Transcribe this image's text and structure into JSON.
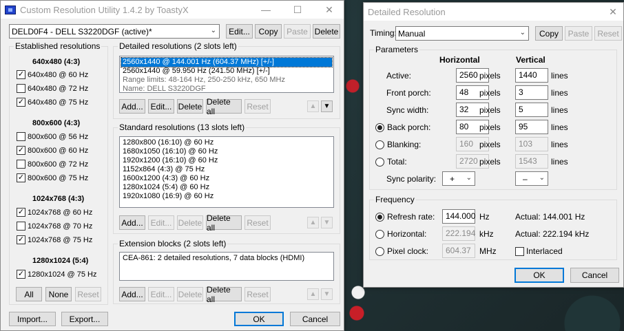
{
  "main": {
    "title": "Custom Resolution Utility 1.4.2 by ToastyX",
    "monitor_select": "DELD0F4 - DELL S3220DGF (active)*",
    "buttons": {
      "edit": "Edit...",
      "copy": "Copy",
      "paste": "Paste",
      "delete": "Delete"
    },
    "established": {
      "label": "Established resolutions",
      "groups": [
        {
          "header": "640x480 (4:3)",
          "items": [
            {
              "label": "640x480 @ 60 Hz",
              "checked": true
            },
            {
              "label": "640x480 @ 72 Hz",
              "checked": false
            },
            {
              "label": "640x480 @ 75 Hz",
              "checked": true
            }
          ]
        },
        {
          "header": "800x600 (4:3)",
          "items": [
            {
              "label": "800x600 @ 56 Hz",
              "checked": false
            },
            {
              "label": "800x600 @ 60 Hz",
              "checked": true
            },
            {
              "label": "800x600 @ 72 Hz",
              "checked": false
            },
            {
              "label": "800x600 @ 75 Hz",
              "checked": true
            }
          ]
        },
        {
          "header": "1024x768 (4:3)",
          "items": [
            {
              "label": "1024x768 @ 60 Hz",
              "checked": true
            },
            {
              "label": "1024x768 @ 70 Hz",
              "checked": false
            },
            {
              "label": "1024x768 @ 75 Hz",
              "checked": true
            }
          ]
        },
        {
          "header": "1280x1024 (5:4)",
          "items": [
            {
              "label": "1280x1024 @ 75 Hz",
              "checked": true
            }
          ]
        }
      ],
      "all": "All",
      "none": "None",
      "reset": "Reset"
    },
    "detailed": {
      "label": "Detailed resolutions (2 slots left)",
      "rows": [
        "2560x1440 @ 144.001 Hz (604.37 MHz) [+/-]",
        "2560x1440 @ 59.950 Hz (241.50 MHz) [+/-]",
        "Range limits: 48-164 Hz, 250-250 kHz, 650 MHz",
        "Name: DELL S3220DGF"
      ],
      "add": "Add...",
      "edit": "Edit...",
      "delete": "Delete",
      "delete_all": "Delete all",
      "reset": "Reset"
    },
    "standard": {
      "label": "Standard resolutions (13 slots left)",
      "rows": [
        "1280x800 (16:10) @ 60 Hz",
        "1680x1050 (16:10) @ 60 Hz",
        "1920x1200 (16:10) @ 60 Hz",
        "1152x864 (4:3) @ 75 Hz",
        "1600x1200 (4:3) @ 60 Hz",
        "1280x1024 (5:4) @ 60 Hz",
        "1920x1080 (16:9) @ 60 Hz"
      ],
      "add": "Add...",
      "edit": "Edit...",
      "delete": "Delete",
      "delete_all": "Delete all",
      "reset": "Reset"
    },
    "extension": {
      "label": "Extension blocks (2 slots left)",
      "rows": [
        "CEA-861: 2 detailed resolutions, 7 data blocks (HDMI)"
      ],
      "add": "Add...",
      "edit": "Edit...",
      "delete": "Delete",
      "delete_all": "Delete all",
      "reset": "Reset"
    },
    "footer": {
      "import": "Import...",
      "export": "Export...",
      "ok": "OK",
      "cancel": "Cancel"
    }
  },
  "detail": {
    "title": "Detailed Resolution",
    "timing_label": "Timing:",
    "timing_value": "Manual",
    "copy": "Copy",
    "paste": "Paste",
    "reset": "Reset",
    "parameters": {
      "label": "Parameters",
      "col_h": "Horizontal",
      "col_v": "Vertical",
      "rows": [
        {
          "label": "Active:",
          "h": "2560",
          "h_unit": "pixels",
          "v": "1440",
          "v_unit": "lines",
          "radio": false
        },
        {
          "label": "Front porch:",
          "h": "48",
          "h_unit": "pixels",
          "v": "3",
          "v_unit": "lines",
          "radio": false
        },
        {
          "label": "Sync width:",
          "h": "32",
          "h_unit": "pixels",
          "v": "5",
          "v_unit": "lines",
          "radio": false
        },
        {
          "label": "Back porch:",
          "h": "80",
          "h_unit": "pixels",
          "v": "95",
          "v_unit": "lines",
          "radio": true,
          "selected": true
        },
        {
          "label": "Blanking:",
          "h": "160",
          "h_unit": "pixels",
          "v": "103",
          "v_unit": "lines",
          "radio": true,
          "selected": false
        },
        {
          "label": "Total:",
          "h": "2720",
          "h_unit": "pixels",
          "v": "1543",
          "v_unit": "lines",
          "radio": true,
          "selected": false
        }
      ],
      "sync_polarity_label": "Sync polarity:",
      "h_polarity": "+",
      "v_polarity": "–"
    },
    "frequency": {
      "label": "Frequency",
      "refresh_label": "Refresh rate:",
      "refresh_value": "144.000",
      "refresh_unit": "Hz",
      "refresh_actual": "Actual: 144.001 Hz",
      "horizontal_label": "Horizontal:",
      "horizontal_value": "222.194",
      "horizontal_unit": "kHz",
      "horizontal_actual": "Actual: 222.194 kHz",
      "pixel_label": "Pixel clock:",
      "pixel_value": "604.37",
      "pixel_unit": "MHz",
      "interlaced_label": "Interlaced"
    },
    "ok": "OK",
    "cancel": "Cancel"
  }
}
